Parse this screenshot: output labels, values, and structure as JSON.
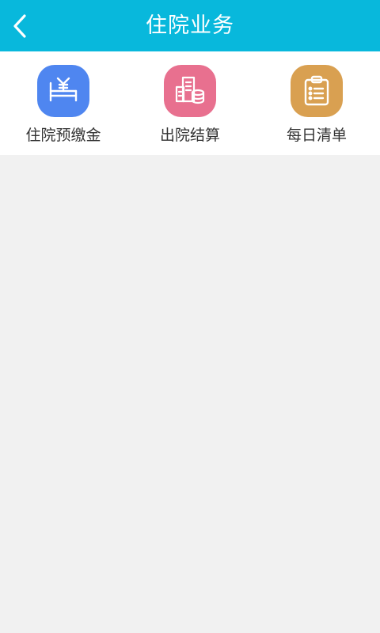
{
  "header": {
    "title": "住院业务",
    "bg_color": "#08b8dc",
    "back_icon": "chevron-left-icon"
  },
  "menu": {
    "items": [
      {
        "label": "住院预缴金",
        "icon": "bed-yen-icon",
        "color": "#4f86f0"
      },
      {
        "label": "出院结算",
        "icon": "building-coins-icon",
        "color": "#e8708f"
      },
      {
        "label": "每日清单",
        "icon": "clipboard-list-icon",
        "color": "#d9a051"
      }
    ]
  }
}
